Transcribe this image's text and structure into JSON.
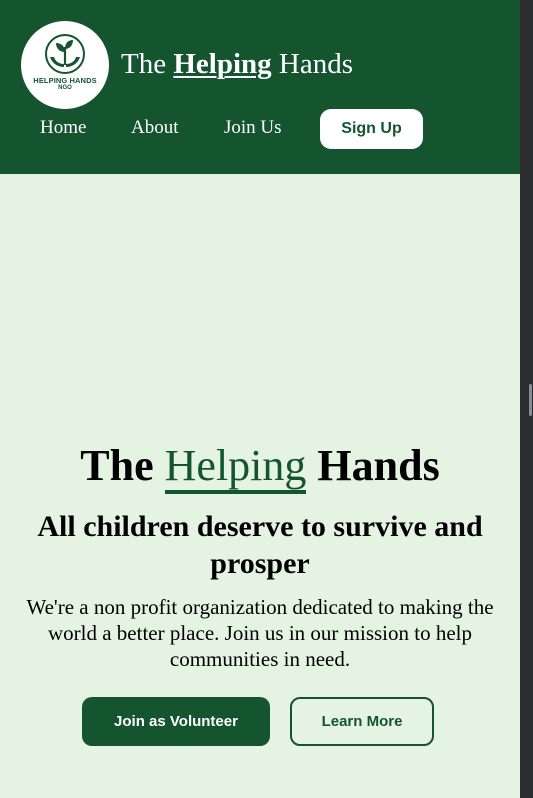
{
  "header": {
    "logo": {
      "icon": "hands-with-sprout-icon",
      "line1": "HELPING HANDS",
      "line2": "NGO"
    },
    "title_pre": "The",
    "title_emph": "Helping",
    "title_post": "Hands",
    "nav": {
      "home": "Home",
      "about": "About",
      "join": "Join Us"
    },
    "signup_label": "Sign Up"
  },
  "hero": {
    "title_pre": "The",
    "title_emph": "Helping",
    "title_post": "Hands",
    "subtitle": "All children deserve to survive and prosper",
    "text": "We're a non profit organization dedicated to making the world a better place. Join us in our mission to help communities in need.",
    "primary_button": "Join as Volunteer",
    "secondary_button": "Learn More"
  },
  "colors": {
    "brand_green": "#145530",
    "background_mint": "#e5f3e3",
    "white": "#ffffff"
  }
}
